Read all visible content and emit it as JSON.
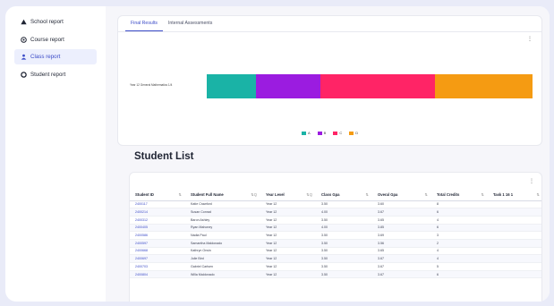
{
  "sidebar": {
    "items": [
      {
        "label": "School report",
        "icon": "triangle-icon"
      },
      {
        "label": "Course report",
        "icon": "circle-icon"
      },
      {
        "label": "Class report",
        "icon": "people-icon"
      },
      {
        "label": "Student report",
        "icon": "ring-icon"
      }
    ],
    "active_index": 2
  },
  "chart_card": {
    "tabs": [
      "Final Results",
      "Internal Assessments"
    ],
    "active_tab": 0,
    "menu_glyph": "⋮"
  },
  "chart_data": {
    "type": "bar",
    "orientation": "horizontal-stacked",
    "categories": [
      "Year 12 General Mathematics 1/4"
    ],
    "series": [
      {
        "name": "A",
        "values": [
          15
        ],
        "color": "#1ab3a6"
      },
      {
        "name": "B",
        "values": [
          20
        ],
        "color": "#9b1ce0"
      },
      {
        "name": "C",
        "values": [
          35
        ],
        "color": "#ff2466"
      },
      {
        "name": "D",
        "values": [
          30
        ],
        "color": "#f59b12"
      }
    ],
    "legend_position": "bottom-center",
    "grid": false
  },
  "student_list": {
    "title": "Student List",
    "menu_glyph": "⋮",
    "columns": [
      "Student ID",
      "Student Full Name",
      "Year Level",
      "Class Gpa",
      "Overal Gpa",
      "Total Credits",
      "Task 1 16 1"
    ],
    "sort_glyph": "⇅",
    "search_glyph": "Q",
    "rows": [
      [
        "2400117",
        "Katie Crawford",
        "Year 12",
        "3.50",
        "3.60",
        "8"
      ],
      [
        "2400214",
        "Susan Conrad",
        "Year 12",
        "4.00",
        "3.67",
        "6"
      ],
      [
        "2400312",
        "Baron Ashley",
        "Year 12",
        "3.50",
        "3.65",
        "4"
      ],
      [
        "2400405",
        "Ryan Mahoney",
        "Year 12",
        "4.00",
        "3.85",
        "6"
      ],
      [
        "2400586",
        "Nadia Paul",
        "Year 12",
        "3.50",
        "3.69",
        "3"
      ],
      [
        "2400597",
        "Samantha Maldonado",
        "Year 12",
        "3.50",
        "3.56",
        "2"
      ],
      [
        "2400668",
        "Kathryn Orwin",
        "Year 12",
        "3.50",
        "3.65",
        "4"
      ],
      [
        "2400697",
        "Julie Bird",
        "Year 12",
        "3.50",
        "3.67",
        "4"
      ],
      [
        "2400703",
        "Gabriel Carlsen",
        "Year 12",
        "3.50",
        "3.67",
        "5"
      ],
      [
        "2400804",
        "Willa Maldonado",
        "Year 12",
        "3.50",
        "3.67",
        "6"
      ]
    ]
  }
}
